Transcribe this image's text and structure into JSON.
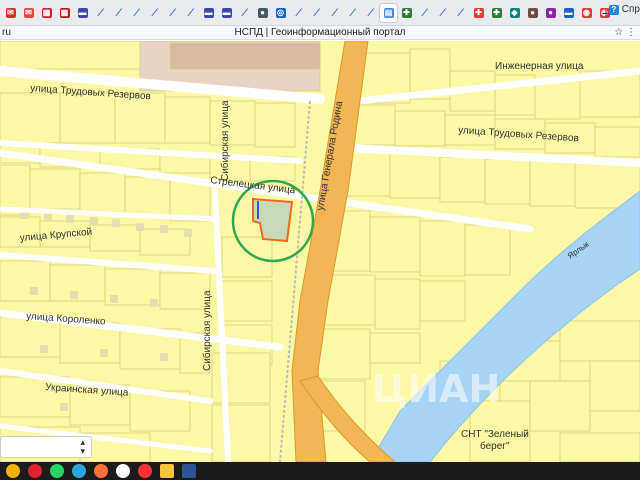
{
  "browser": {
    "tabs": [
      {
        "icon": "mail-icon",
        "color": "#d93025",
        "glyph": "✉"
      },
      {
        "icon": "mail-icon",
        "color": "#e8453c",
        "glyph": "✉"
      },
      {
        "icon": "calendar-icon",
        "color": "#c62828",
        "glyph": "▦"
      },
      {
        "icon": "calendar-icon",
        "color": "#b71c1c",
        "glyph": "▦"
      },
      {
        "icon": "ru-flag-icon",
        "color": "#3949ab",
        "glyph": "▬"
      },
      {
        "icon": "slash-icon",
        "color": "#1e6fd9",
        "glyph": "⁄"
      },
      {
        "icon": "slash-icon",
        "color": "#1e6fd9",
        "glyph": "⁄"
      },
      {
        "icon": "slash-icon",
        "color": "#1e6fd9",
        "glyph": "⁄"
      },
      {
        "icon": "slash-icon",
        "color": "#1e6fd9",
        "glyph": "⁄"
      },
      {
        "icon": "slash-icon",
        "color": "#1e6fd9",
        "glyph": "⁄"
      },
      {
        "icon": "slash-icon",
        "color": "#1e6fd9",
        "glyph": "⁄"
      },
      {
        "icon": "ru-flag-icon",
        "color": "#3949ab",
        "glyph": "▬"
      },
      {
        "icon": "ru-flag-icon",
        "color": "#3949ab",
        "glyph": "▬"
      },
      {
        "icon": "slash-icon",
        "color": "#1e6fd9",
        "glyph": "⁄"
      },
      {
        "icon": "circle-icon",
        "color": "#455a64",
        "glyph": "●"
      },
      {
        "icon": "globe-icon",
        "color": "#1565c0",
        "glyph": "◎"
      },
      {
        "icon": "slash-icon",
        "color": "#1e6fd9",
        "glyph": "⁄"
      },
      {
        "icon": "slash-icon",
        "color": "#1e6fd9",
        "glyph": "⁄"
      },
      {
        "icon": "slash-icon",
        "color": "#1e6fd9",
        "glyph": "⁄"
      },
      {
        "icon": "slash-icon",
        "color": "#1e6fd9",
        "glyph": "⁄"
      },
      {
        "icon": "slash-icon",
        "color": "#1e6fd9",
        "glyph": "⁄"
      },
      {
        "icon": "doc-icon",
        "color": "#4285f4",
        "glyph": "▤",
        "active": true
      },
      {
        "icon": "puzzle-icon",
        "color": "#2e7d32",
        "glyph": "✚"
      },
      {
        "icon": "slash-icon",
        "color": "#1e6fd9",
        "glyph": "⁄"
      },
      {
        "icon": "slash-icon",
        "color": "#1e6fd9",
        "glyph": "⁄"
      },
      {
        "icon": "slash-icon",
        "color": "#1e6fd9",
        "glyph": "⁄"
      },
      {
        "icon": "cross-icon",
        "color": "#e53935",
        "glyph": "✚"
      },
      {
        "icon": "puzzle-icon",
        "color": "#2e7d32",
        "glyph": "✚"
      },
      {
        "icon": "shield-icon",
        "color": "#00897b",
        "glyph": "◆"
      },
      {
        "icon": "avatar-icon",
        "color": "#6d4c41",
        "glyph": "●"
      },
      {
        "icon": "user-icon",
        "color": "#8e24aa",
        "glyph": "●"
      },
      {
        "icon": "card-icon",
        "color": "#1565c0",
        "glyph": "▬"
      },
      {
        "icon": "ring-icon",
        "color": "#e53935",
        "glyph": "◉"
      },
      {
        "icon": "ring-icon",
        "color": "#e53935",
        "glyph": "◉"
      }
    ],
    "last_tab_title": "Спр",
    "url": "ru",
    "page_title": "НСПД | Геоинформационный портал"
  },
  "map": {
    "labels": {
      "inzhenernaya": "Инженерная улица",
      "trudovykh_rezervov_1": "улица Трудовых Резервов",
      "trudovykh_rezervov_2": "улица Трудовых Резервов",
      "sibirskaya_1": "Сибирская улица",
      "sibirskaya_2": "Сибирская улица",
      "streletskaya": "Стрелецкая улица",
      "generala_rodina": "улица Генерала Родина",
      "krupskoy": "улица Крупской",
      "korolenko": "улица Короленко",
      "ukrainskaya": "Украинская улица",
      "river": "Ярлык",
      "snt_1": "СНТ \"Зеленый",
      "snt_2": "берег\""
    },
    "watermark": "ЦИАН",
    "colors": {
      "parcel_fill": "#fbf8a6",
      "parcel_stroke": "#d8d27a",
      "road": "#ffffff",
      "main_road": "#f2b654",
      "river": "#a7d3f7",
      "highlight_circle": "#2fa84f",
      "selected_outline": "#f06a1c",
      "selected_blue": "#3a4fe0"
    }
  },
  "taskbar": {
    "apps": [
      {
        "icon": "chrome-icon",
        "color": "#f0b400"
      },
      {
        "icon": "opera-icon",
        "color": "#e0212f"
      },
      {
        "icon": "whatsapp-icon",
        "color": "#25d366"
      },
      {
        "icon": "telegram-icon",
        "color": "#2aa6de"
      },
      {
        "icon": "firefox-icon",
        "color": "#ff7139"
      },
      {
        "icon": "yandex-browser-icon",
        "color": "#ffffff"
      },
      {
        "icon": "yandex-icon",
        "color": "#ff3333"
      },
      {
        "icon": "explorer-icon",
        "color": "#f6c342"
      },
      {
        "icon": "word-icon",
        "color": "#2b579a"
      }
    ]
  }
}
